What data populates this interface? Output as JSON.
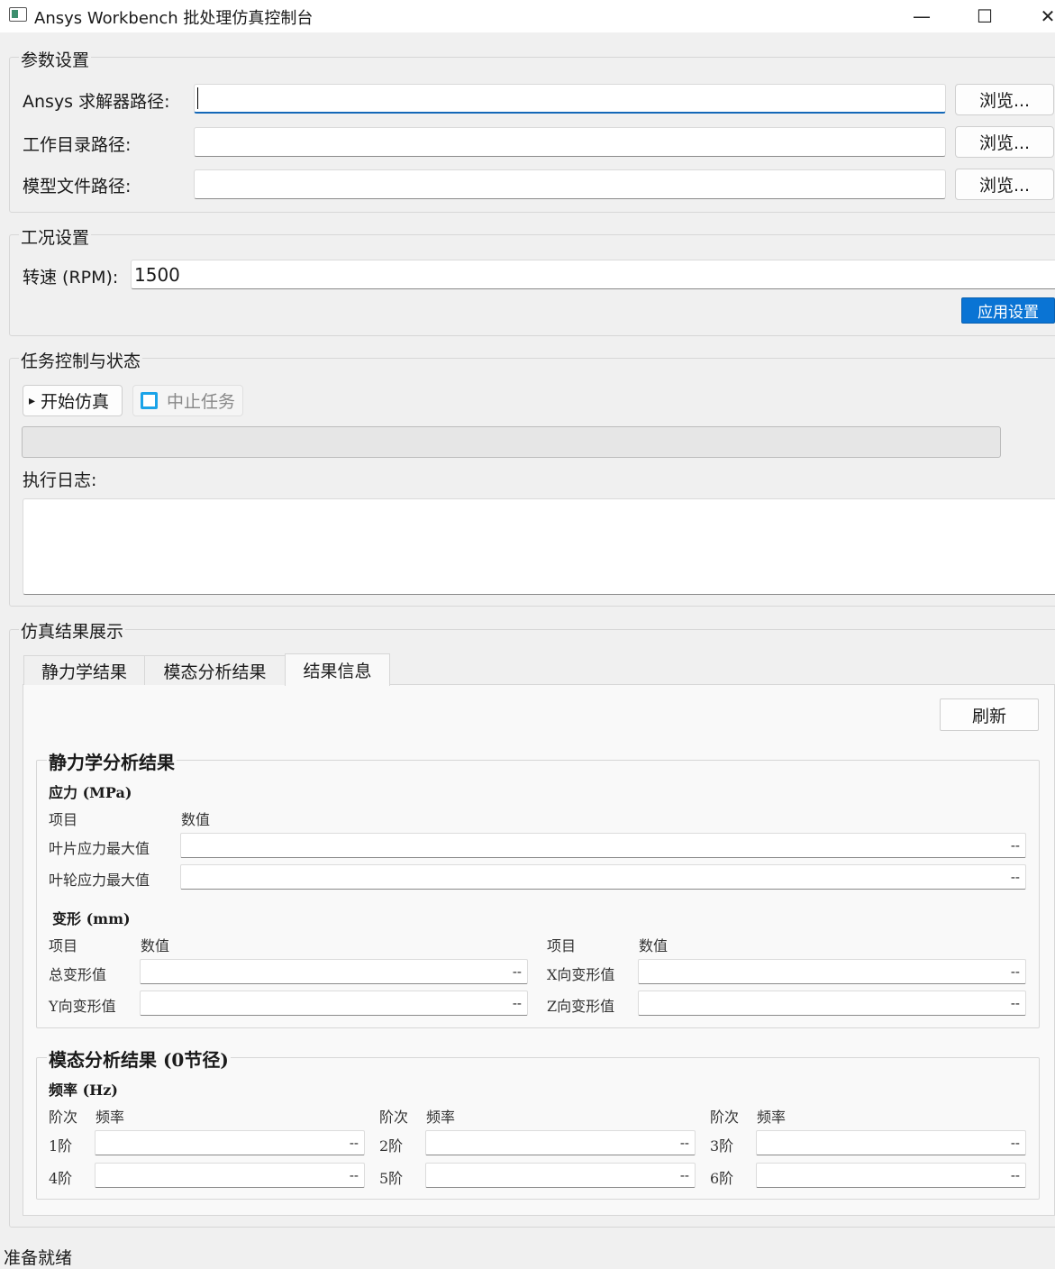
{
  "window": {
    "title": "Ansys Workbench 批处理仿真控制台",
    "minimize_glyph": "—",
    "maximize_glyph": "☐",
    "close_glyph": "✕"
  },
  "params": {
    "title": "参数设置",
    "solver_label": "Ansys 求解器路径:",
    "solver_value": "",
    "workdir_label": "工作目录路径:",
    "workdir_value": "",
    "model_label": "模型文件路径:",
    "model_value": "",
    "browse_label": "浏览..."
  },
  "conditions": {
    "title": "工况设置",
    "rpm_label": "转速 (RPM):",
    "rpm_value": "1500",
    "apply_label": "应用设置"
  },
  "task": {
    "title": "任务控制与状态",
    "start_label": "开始仿真",
    "start_icon": "▸",
    "stop_label": "中止任务",
    "progress_value": 0,
    "log_label": "执行日志:",
    "log_text": ""
  },
  "results": {
    "title": "仿真结果展示",
    "tabs": [
      "静力学结果",
      "模态分析结果",
      "结果信息"
    ],
    "active_tab": 2,
    "refresh_label": "刷新",
    "static": {
      "title": "静力学分析结果",
      "stress_title": "应力 (MPa)",
      "col_item": "项目",
      "col_value": "数值",
      "blade_label": "叶片应力最大值",
      "blade_value": "--",
      "wheel_label": "叶轮应力最大值",
      "wheel_value": "--",
      "deform_title": "变形 (mm)",
      "total_label": "总变形值",
      "total_value": "--",
      "x_label": "X向变形值",
      "x_value": "--",
      "y_label": "Y向变形值",
      "y_value": "--",
      "z_label": "Z向变形值",
      "z_value": "--"
    },
    "modal": {
      "title": "模态分析结果 (0节径)",
      "freq_title": "频率 (Hz)",
      "col_order": "阶次",
      "col_freq": "频率",
      "modes": [
        {
          "label": "1阶",
          "value": "--"
        },
        {
          "label": "2阶",
          "value": "--"
        },
        {
          "label": "3阶",
          "value": "--"
        },
        {
          "label": "4阶",
          "value": "--"
        },
        {
          "label": "5阶",
          "value": "--"
        },
        {
          "label": "6阶",
          "value": "--"
        }
      ]
    }
  },
  "status_bar": {
    "text": "准备就绪"
  }
}
